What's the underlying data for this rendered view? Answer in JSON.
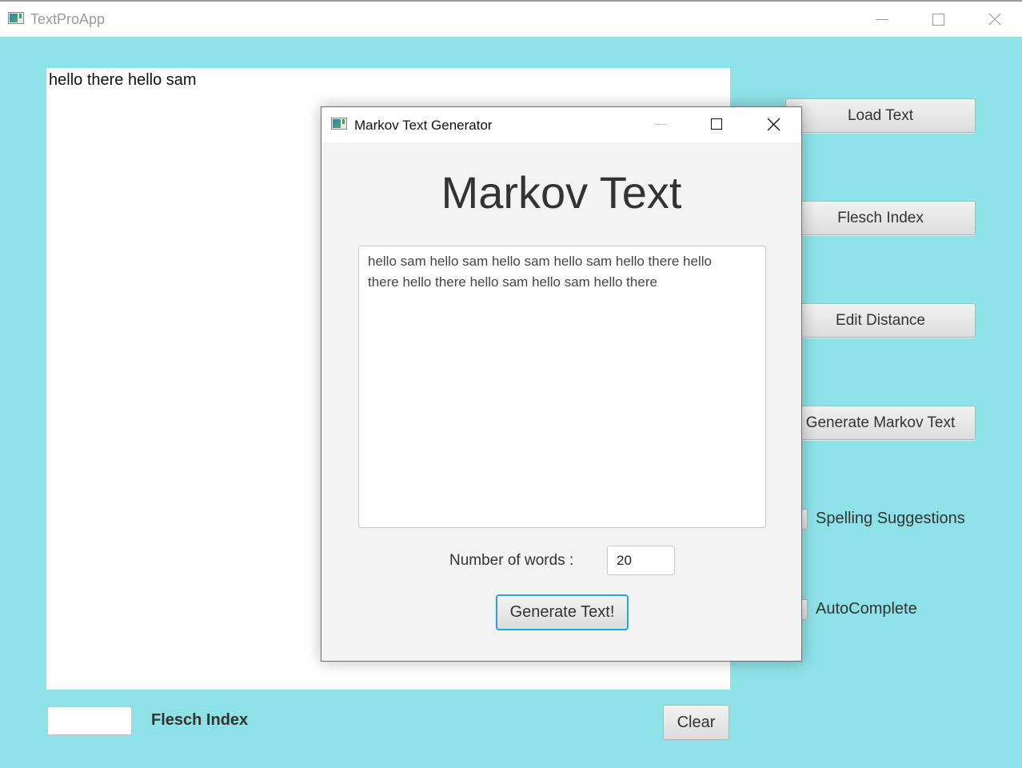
{
  "main_window": {
    "title": "TextProApp",
    "icon": "app-window-icon",
    "controls": {
      "minimize": "minimize-icon",
      "maximize": "maximize-icon",
      "close": "close-icon"
    },
    "text_area": {
      "value": "hello there hello sam"
    },
    "side_buttons": [
      {
        "label": "Load Text"
      },
      {
        "label": "Flesch Index"
      },
      {
        "label": "Edit Distance"
      },
      {
        "label": "Generate Markov Text"
      }
    ],
    "checkboxes": [
      {
        "label": "Spelling Suggestions",
        "checked": false
      },
      {
        "label": "AutoComplete",
        "checked": false
      }
    ],
    "flesch_field": {
      "value": ""
    },
    "flesch_label": "Flesch Index",
    "clear_button": "Clear",
    "background_color": "#8de2e8"
  },
  "dialog": {
    "title": "Markov Text Generator",
    "icon": "app-window-icon",
    "heading": "Markov Text",
    "generated_text": "hello sam hello sam hello sam hello sam hello there hello there hello there hello sam hello sam hello there",
    "words_label": "Number of words :",
    "words_value": "20",
    "generate_button": "Generate Text!",
    "focus_color": "#2aa3d9"
  }
}
